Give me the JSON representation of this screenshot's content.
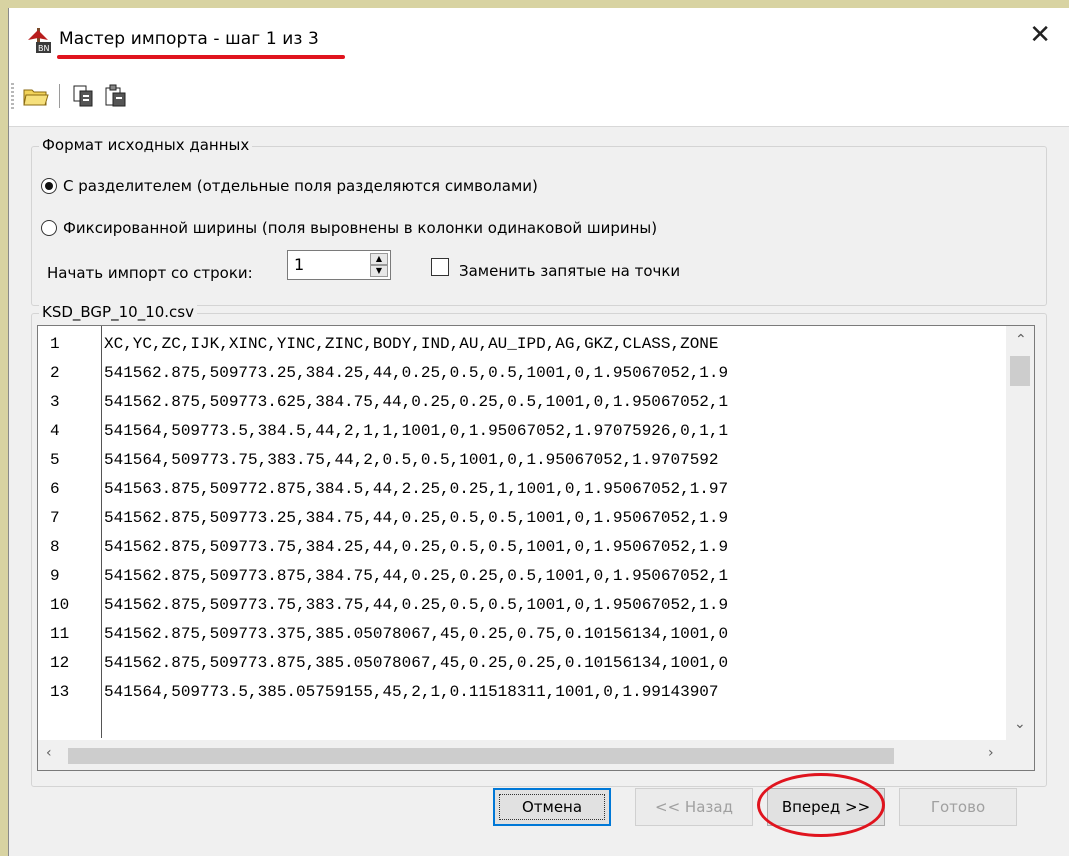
{
  "window": {
    "title": "Мастер импорта - шаг 1 из 3",
    "close_glyph": "✕",
    "accent_color": "#e0141e"
  },
  "toolbar": {
    "icons": [
      "open-folder-icon",
      "copy-icon",
      "paste-icon"
    ]
  },
  "format_group": {
    "legend": "Формат исходных данных",
    "options": [
      {
        "label": "С разделителем (отдельные поля разделяются символами)",
        "selected": true
      },
      {
        "label": "Фиксированной ширины (поля выровнены в колонки одинаковой ширины)",
        "selected": false
      }
    ],
    "start_row_label": "Начать импорт со строки:",
    "start_row_value": "1",
    "replace_commas_label": "Заменить запятые на точки",
    "replace_commas_checked": false
  },
  "file_group": {
    "legend": "KSD_BGP_10_10.csv",
    "lines": [
      {
        "num": "1",
        "text": "XC,YC,ZC,IJK,XINC,YINC,ZINC,BODY,IND,AU,AU_IPD,AG,GKZ,CLASS,ZONE"
      },
      {
        "num": "2",
        "text": "541562.875,509773.25,384.25,44,0.25,0.5,0.5,1001,0,1.95067052,1.9"
      },
      {
        "num": "3",
        "text": "541562.875,509773.625,384.75,44,0.25,0.25,0.5,1001,0,1.95067052,1"
      },
      {
        "num": "4",
        "text": "541564,509773.5,384.5,44,2,1,1,1001,0,1.95067052,1.97075926,0,1,1"
      },
      {
        "num": "5",
        "text": "541564,509773.75,383.75,44,2,0.5,0.5,1001,0,1.95067052,1.9707592"
      },
      {
        "num": "6",
        "text": "541563.875,509772.875,384.5,44,2.25,0.25,1,1001,0,1.95067052,1.97"
      },
      {
        "num": "7",
        "text": "541562.875,509773.25,384.75,44,0.25,0.5,0.5,1001,0,1.95067052,1.9"
      },
      {
        "num": "8",
        "text": "541562.875,509773.75,384.25,44,0.25,0.5,0.5,1001,0,1.95067052,1.9"
      },
      {
        "num": "9",
        "text": "541562.875,509773.875,384.75,44,0.25,0.25,0.5,1001,0,1.95067052,1"
      },
      {
        "num": "10",
        "text": "541562.875,509773.75,383.75,44,0.25,0.5,0.5,1001,0,1.95067052,1.9"
      },
      {
        "num": "11",
        "text": "541562.875,509773.375,385.05078067,45,0.25,0.75,0.10156134,1001,0"
      },
      {
        "num": "12",
        "text": "541562.875,509773.875,385.05078067,45,0.25,0.25,0.10156134,1001,0"
      },
      {
        "num": "13",
        "text": "541564,509773.5,385.05759155,45,2,1,0.11518311,1001,0,1.99143907"
      }
    ]
  },
  "buttons": {
    "cancel": "Отмена",
    "back": "<< Назад",
    "next": "Вперед >>",
    "finish": "Готово"
  }
}
